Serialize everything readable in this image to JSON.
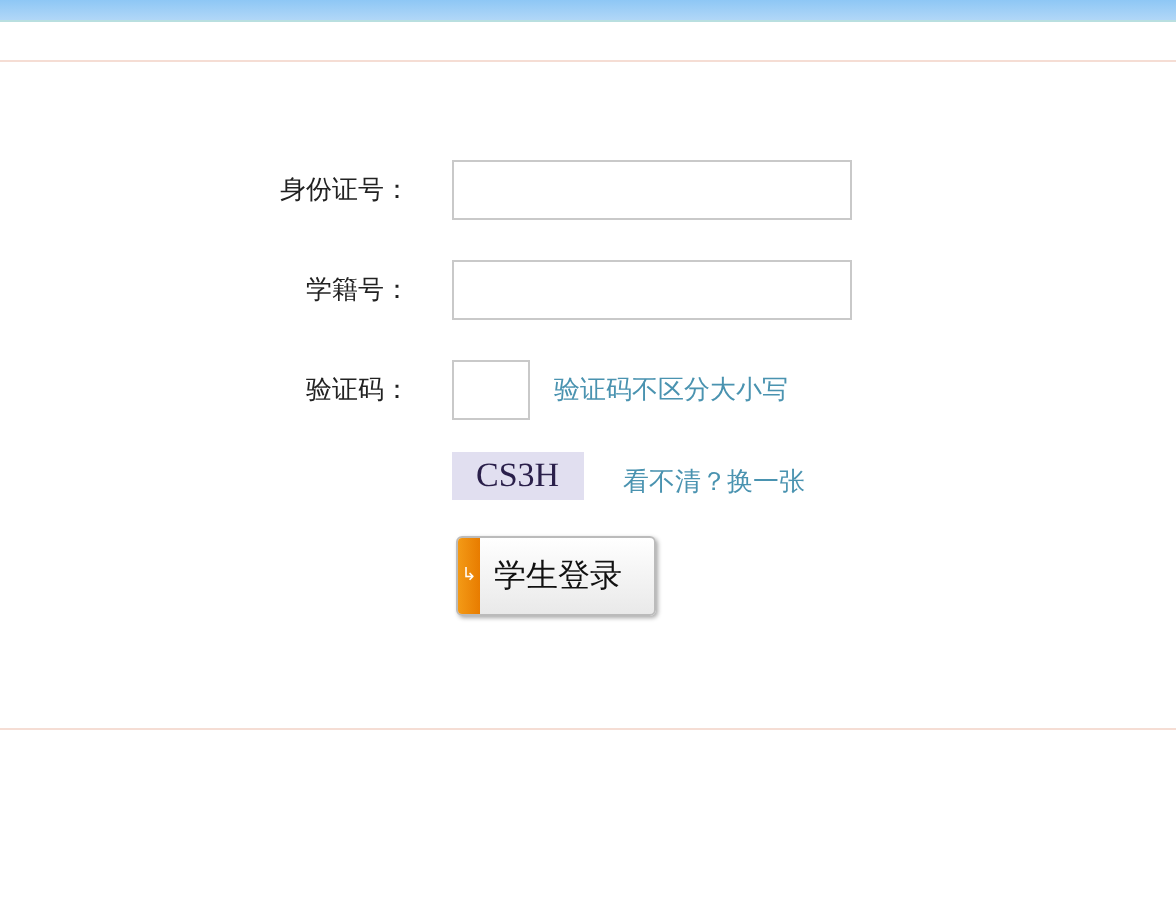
{
  "fields": [
    {
      "label": "身份证号：",
      "kind": "text"
    },
    {
      "label": "学籍号：",
      "kind": "text"
    },
    {
      "label": "验证码：",
      "kind": "captcha",
      "hint": "验证码不区分大小写"
    }
  ],
  "captcha": {
    "code": "CS3H",
    "refresh_link": "看不清？换一张"
  },
  "login_button": {
    "icon": "↳",
    "label": "学生登录"
  }
}
